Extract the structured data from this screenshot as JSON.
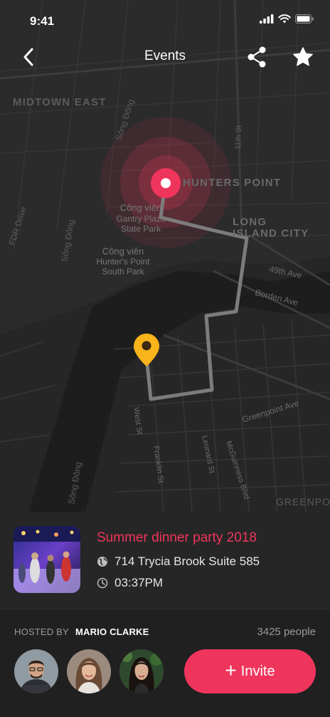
{
  "status_bar": {
    "time": "9:41"
  },
  "nav": {
    "title": "Events"
  },
  "map": {
    "labels": {
      "midtown_east": "MIDTOWN EAST",
      "hunters_point": "HUNTERS POINT",
      "long_island_city_1": "LONG",
      "long_island_city_2": "ISLAND CITY",
      "park1_1": "Công viên",
      "park1_2": "Gantry Plaza",
      "park1_3": "State Park",
      "park2_1": "Công viên",
      "park2_2": "Hunter's Point",
      "park2_3": "South Park",
      "ave_49th": "49th Ave",
      "borden_ave": "Borden Ave",
      "greenpoint_ave": "Greenpoint Ave",
      "greenpoint": "GREENPOINT",
      "fdr_drive": "FDR Drive",
      "song_dong_1": "Sông Đông",
      "song_dong_2": "Sông Đông",
      "song_dong_3": "Sông Đông",
      "west_st": "West St",
      "franklin_st": "Franklin St",
      "leonard_st": "Leonard St",
      "mcguinness_blvd": "McGuinness Blvd",
      "st_11th": "11th St"
    },
    "route_color": "#7c7c7c",
    "destination_color": "#f0355d",
    "origin_color": "#f8b41a"
  },
  "event": {
    "title": "Summer dinner party 2018",
    "address": "714 Trycia Brook Suite 585",
    "time": "03:37PM"
  },
  "host": {
    "label": "HOSTED BY",
    "name": "MARIO CLARKE",
    "people": "3425 people"
  },
  "invite": {
    "label": "Invite"
  },
  "colors": {
    "accent": "#f0355d",
    "background": "#202020",
    "card": "#262626"
  }
}
